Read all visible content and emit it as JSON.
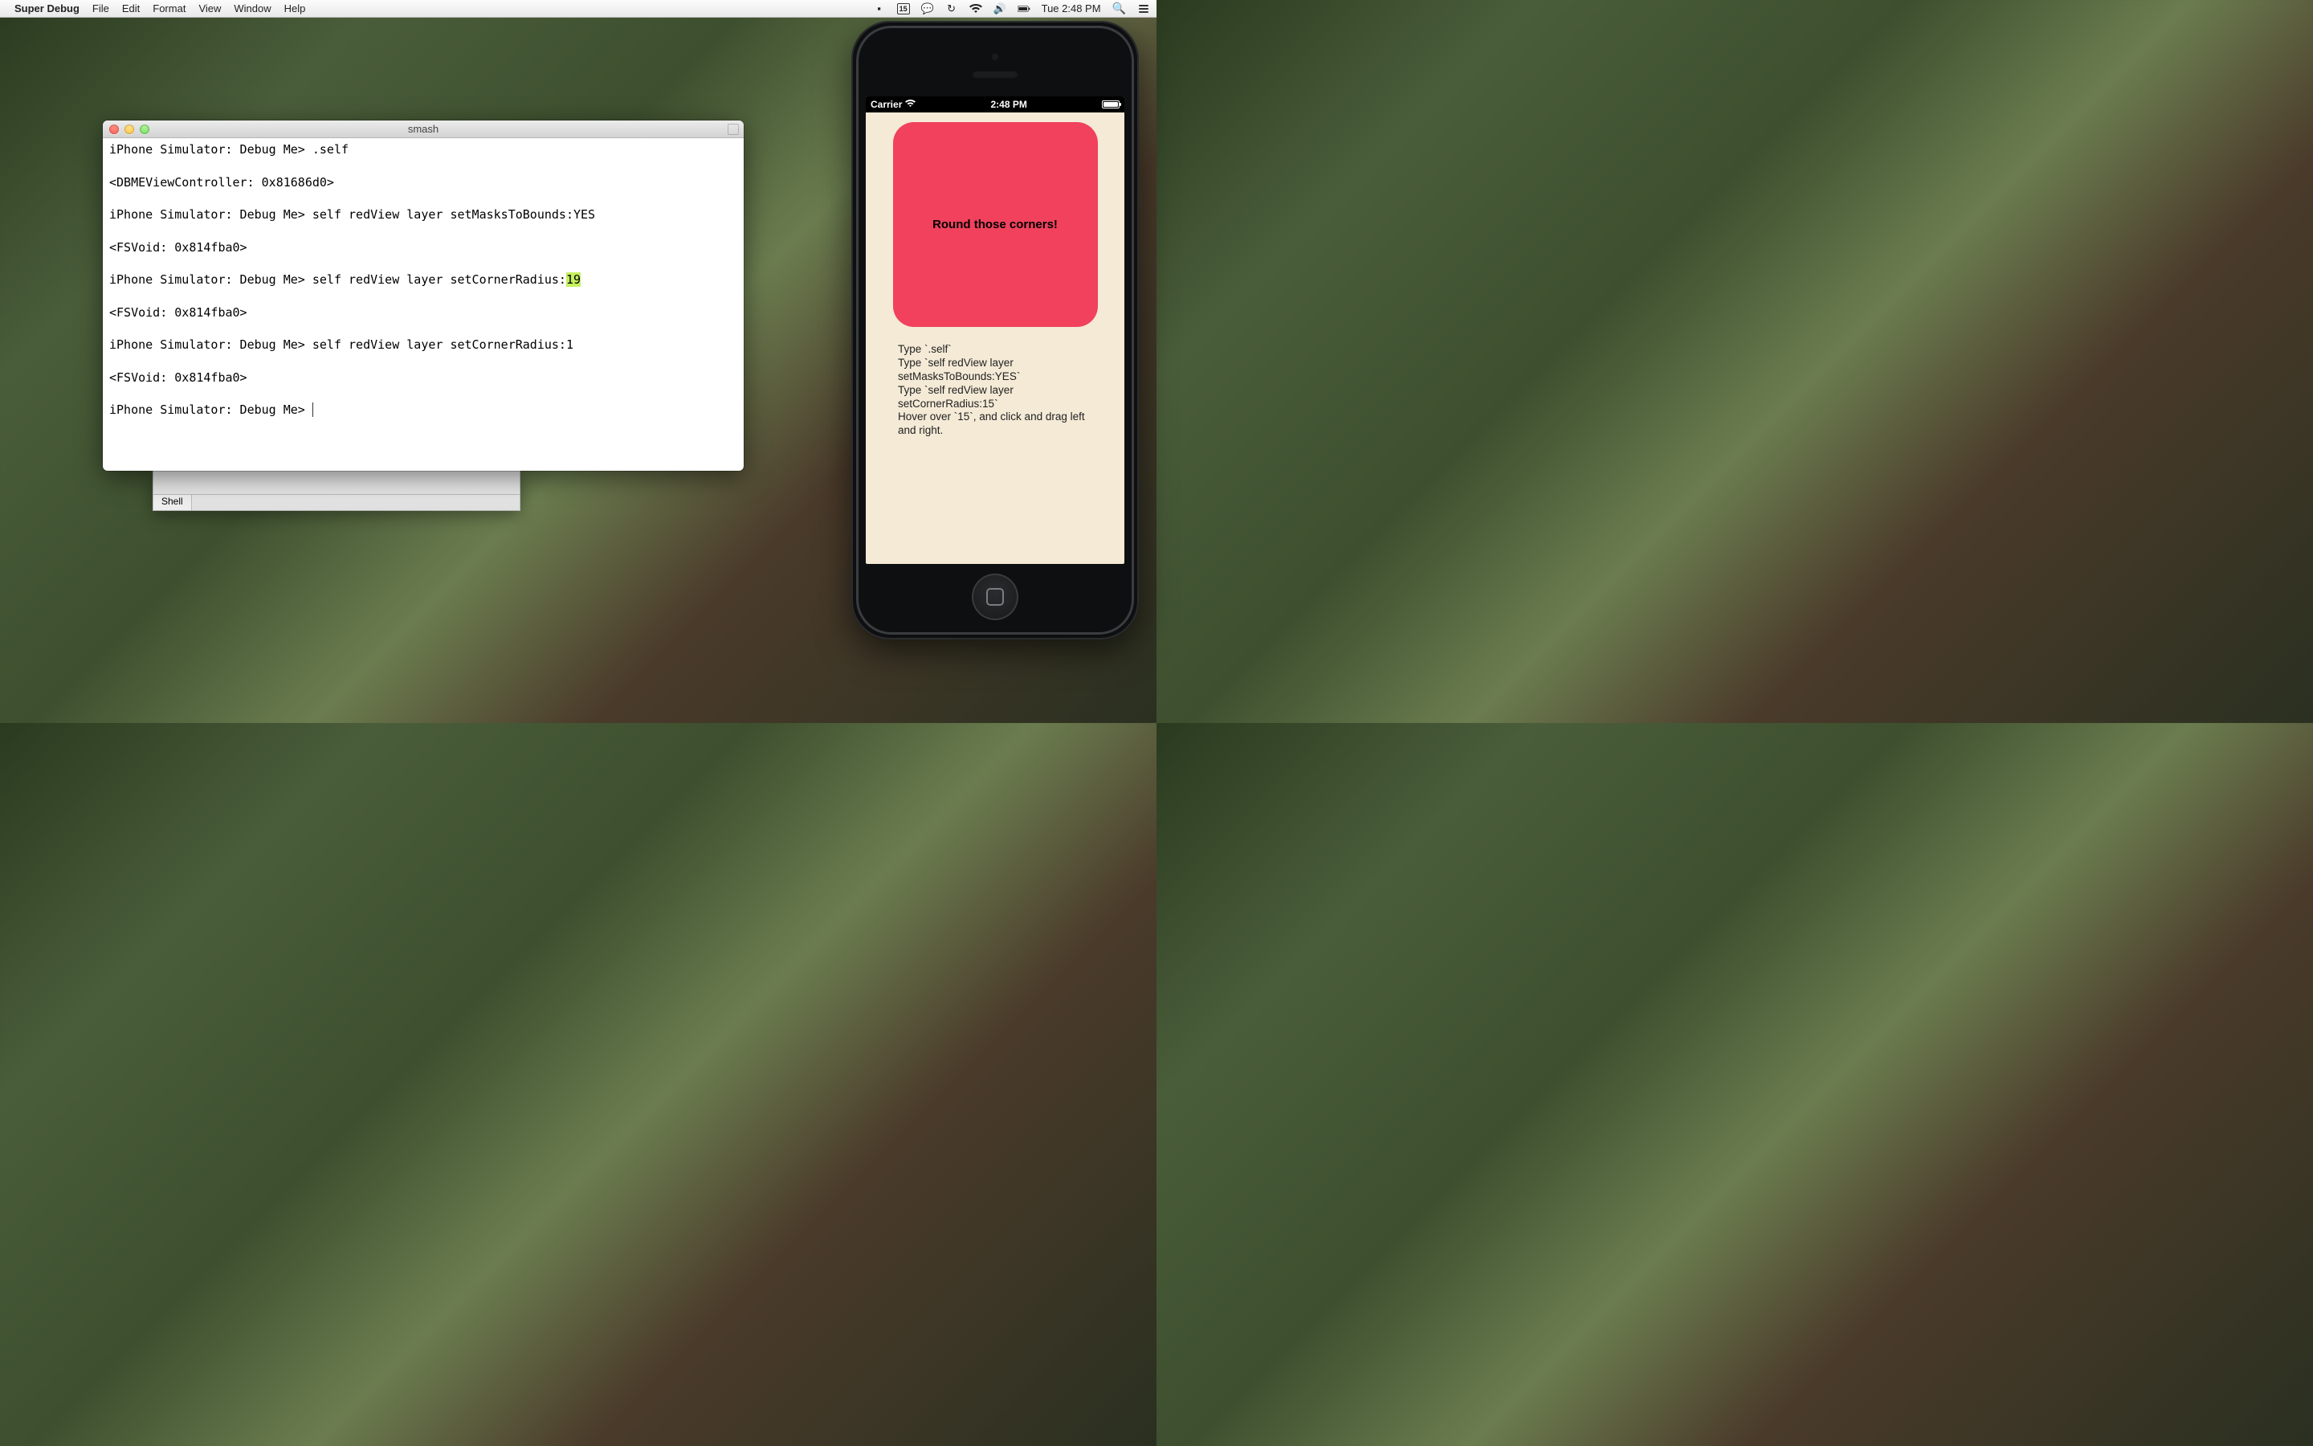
{
  "menubar": {
    "apple": "",
    "app": "Super Debug",
    "items": [
      "File",
      "Edit",
      "Format",
      "View",
      "Window",
      "Help"
    ],
    "calendar_day": "15",
    "clock": "Tue 2:48 PM"
  },
  "terminal": {
    "title": "smash",
    "lines": [
      {
        "prompt": "iPhone Simulator: Debug Me> ",
        "cmd": ".self",
        "resp": ""
      },
      {
        "resp": "<DBMEViewController: 0x81686d0>"
      },
      {
        "prompt": "iPhone Simulator: Debug Me> ",
        "cmd": "self redView layer setMasksToBounds:YES",
        "resp": ""
      },
      {
        "resp": "<FSVoid: 0x814fba0>"
      },
      {
        "prompt": "iPhone Simulator: Debug Me> ",
        "cmd": "self redView layer setCornerRadius:",
        "hl": "19",
        "resp": ""
      },
      {
        "resp": "<FSVoid: 0x814fba0>"
      },
      {
        "prompt": "iPhone Simulator: Debug Me> ",
        "cmd": "self redView layer setCornerRadius:1",
        "resp": ""
      },
      {
        "resp": "<FSVoid: 0x814fba0>"
      },
      {
        "prompt": "iPhone Simulator: Debug Me> ",
        "cmd": "",
        "cursor": true
      }
    ]
  },
  "shell_tab": {
    "label": "Shell"
  },
  "simulator": {
    "statusbar": {
      "carrier": "Carrier",
      "time": "2:48 PM"
    },
    "redview_label": "Round those corners!",
    "instructions": [
      "Type `.self`",
      "Type `self redView layer setMasksToBounds:YES`",
      "Type `self redView layer setCornerRadius:15`",
      "Hover over `15`, and click and drag left and right."
    ],
    "corner_radius": 19,
    "colors": {
      "red": "#f1415d",
      "screen_bg": "#f4ead6"
    }
  }
}
